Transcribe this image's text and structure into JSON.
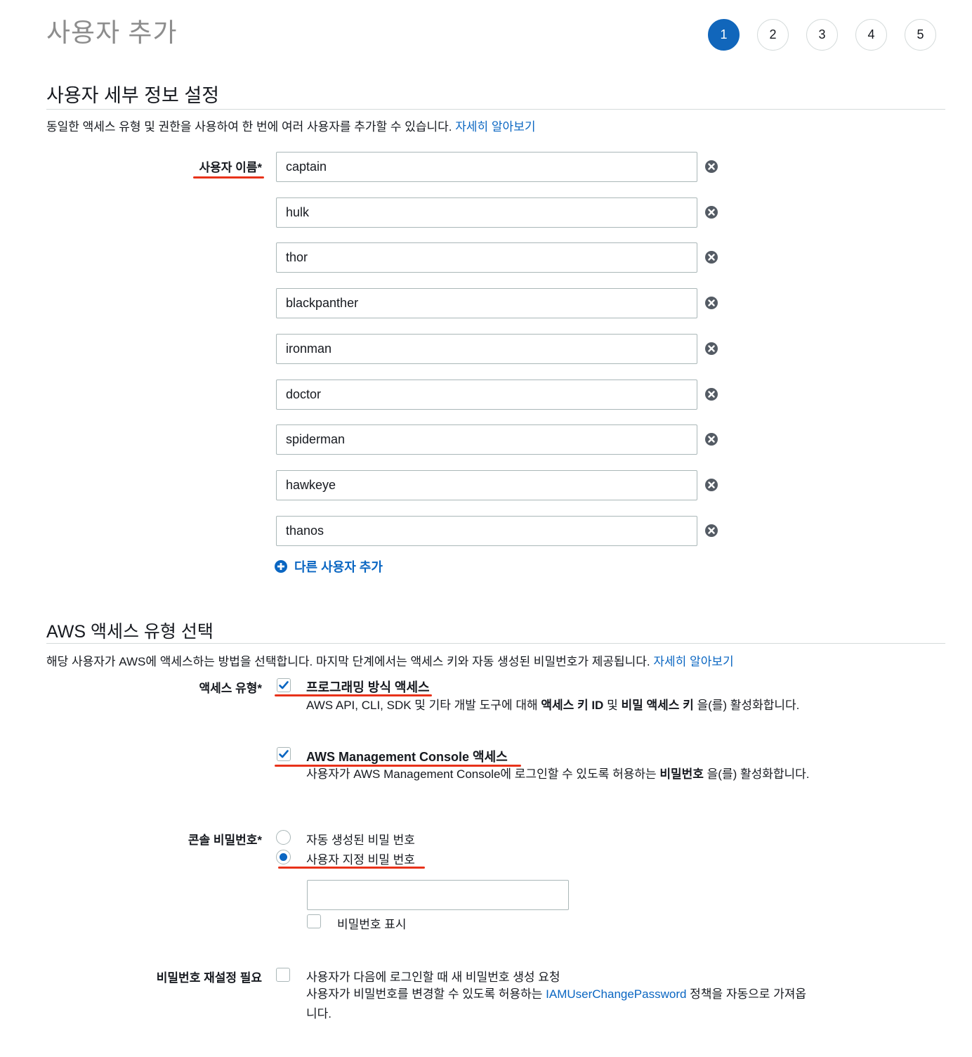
{
  "page": {
    "title": "사용자 추가"
  },
  "steps": [
    "1",
    "2",
    "3",
    "4",
    "5"
  ],
  "user_details": {
    "title": "사용자 세부 정보 설정",
    "description": "동일한 액세스 유형 및 권한을 사용하여 한 번에 여러 사용자를 추가할 수 있습니다.",
    "learn_more": "자세히 알아보기",
    "username_label": "사용자 이름*",
    "usernames": [
      "captain",
      "hulk",
      "thor",
      "blackpanther",
      "ironman",
      "doctor",
      "spiderman",
      "hawkeye",
      "thanos"
    ],
    "add_user_label": "다른 사용자 추가"
  },
  "access_type": {
    "title": "AWS 액세스 유형 선택",
    "description": "해당 사용자가 AWS에 액세스하는 방법을 선택합니다. 마지막 단계에서는 액세스 키와 자동 생성된 비밀번호가 제공됩니다.",
    "learn_more": "자세히 알아보기",
    "label": "액세스 유형*",
    "programmatic": {
      "checked": true,
      "label": "프로그래밍 방식 액세스",
      "desc_pre": "AWS API, CLI, SDK 및 기타 개발 도구에 대해 ",
      "desc_bold1": "액세스 키 ID",
      "desc_mid": " 및 ",
      "desc_bold2": "비밀 액세스 키",
      "desc_post": " 을(를) 활성화합니다."
    },
    "console": {
      "checked": true,
      "label": "AWS Management Console 액세스",
      "desc_pre": "사용자가 AWS Management Console에 로그인할 수 있도록 허용하는 ",
      "desc_bold": "비밀번호",
      "desc_post": " 을(를) 활성화합니다."
    }
  },
  "console_password": {
    "label": "콘솔 비밀번호*",
    "options": [
      "자동 생성된 비밀 번호",
      "사용자 지정 비밀 번호"
    ],
    "selected_index": 1,
    "value": "",
    "show_password_label": "비밀번호 표시"
  },
  "password_reset": {
    "label": "비밀번호 재설정 필요",
    "checked": false,
    "option_label": "사용자가 다음에 로그인할 때 새 비밀번호 생성 요청",
    "desc_pre": "사용자가 비밀번호를 변경할 수 있도록 허용하는 ",
    "desc_link": "IAMUserChangePassword",
    "desc_post": " 정책을 자동으로 가져옵니다."
  },
  "colors": {
    "accent": "#1166bb",
    "link": "#0a66c2",
    "annotation": "#e8321a"
  }
}
